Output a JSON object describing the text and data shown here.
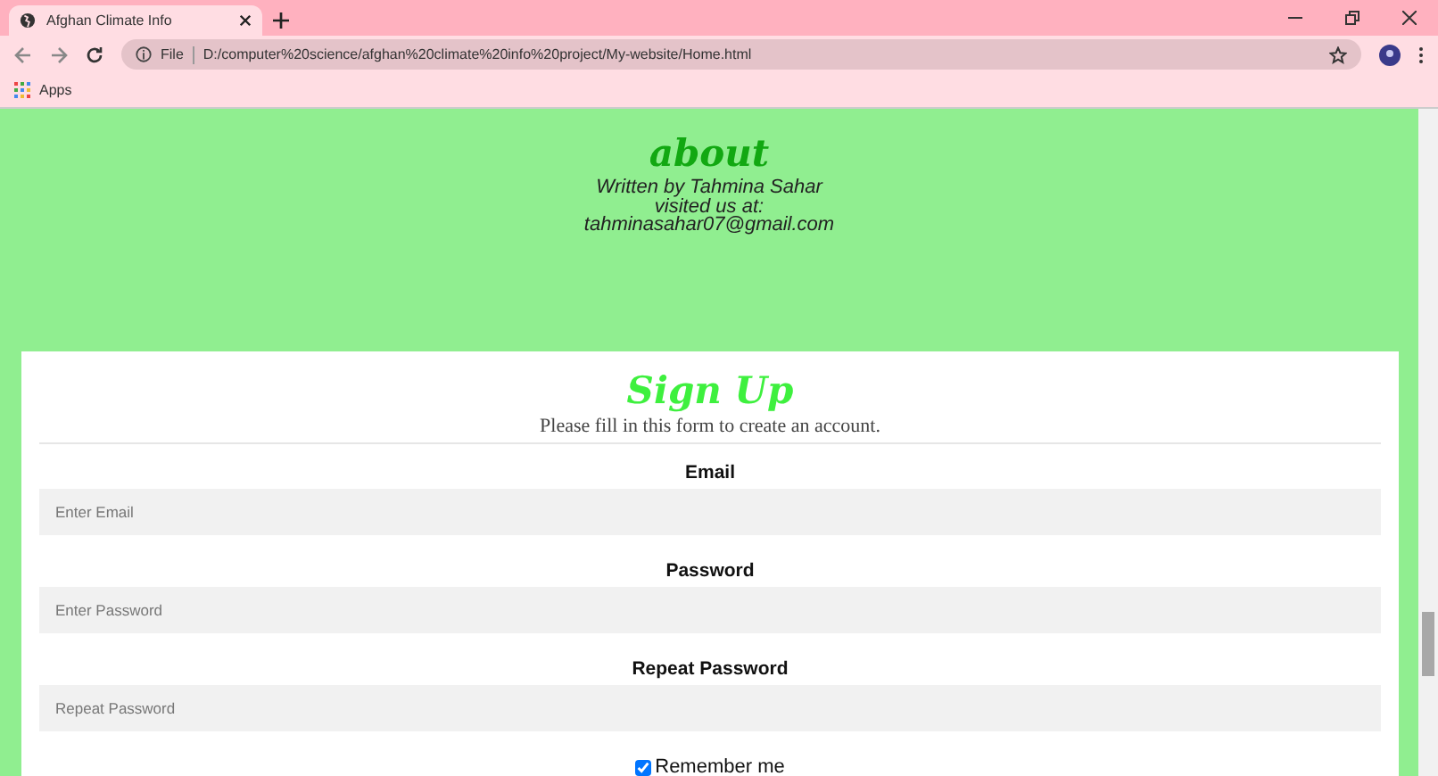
{
  "browser": {
    "tab_title": "Afghan Climate Info",
    "url_scheme": "File",
    "url": "D:/computer%20science/afghan%20climate%20info%20project/My-website/Home.html",
    "bookmarks": [
      "Apps"
    ]
  },
  "about": {
    "title": "about",
    "lines": [
      "Written by Tahmina Sahar",
      "visited us at:",
      "tahminasahar07@gmail.com"
    ]
  },
  "signup": {
    "title": "Sign Up",
    "subtitle": "Please fill in this form to create an account.",
    "fields": [
      {
        "label": "Email",
        "placeholder": "Enter Email"
      },
      {
        "label": "Password",
        "placeholder": "Enter Password"
      },
      {
        "label": "Repeat Password",
        "placeholder": "Repeat Password"
      }
    ],
    "remember": {
      "label": "Remember me",
      "checked": true
    }
  }
}
